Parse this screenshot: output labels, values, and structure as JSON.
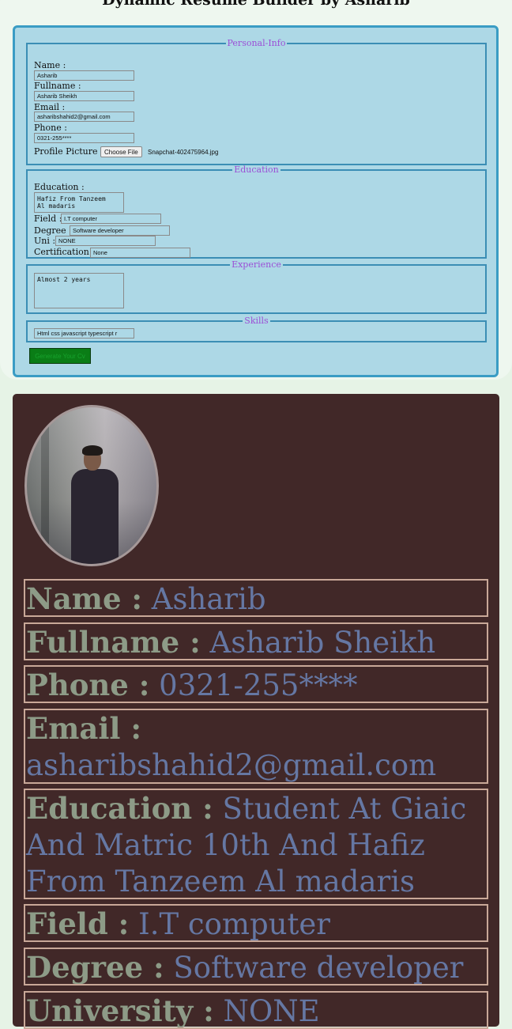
{
  "app": {
    "title": "Dynamic Resume Builder by Asharib"
  },
  "form": {
    "personal": {
      "legend": "Personal-Info",
      "name_label": "Name :",
      "name_value": "Asharib",
      "fullname_label": "Fullname :",
      "fullname_value": "Asharib Sheikh",
      "email_label": "Email :",
      "email_value": "asharibshahid2@gmail.com",
      "phone_label": "Phone :",
      "phone_value": "0321-255****",
      "picture_label": "Profile Picture :",
      "choose_file": "Choose File",
      "file_name": "Snapchat-402475964.jpg"
    },
    "education": {
      "legend": "Education",
      "education_label": "Education :",
      "education_value": "Hafiz From Tanzeem\nAl madaris",
      "field_label": "Field :",
      "field_value": "I.T computer",
      "degree_label": "Degree :",
      "degree_value": "Software developer",
      "uni_label": "Uni :",
      "uni_value": "NONE",
      "certification_label": "Certification :",
      "certification_value": "None"
    },
    "experience": {
      "legend": "Experience",
      "value": "Almost 2 years"
    },
    "skills": {
      "legend": "Skills",
      "value": "Html css javascript typescript r"
    },
    "generate_button": "Generate Your Cv"
  },
  "resume": {
    "name_label": "Name :",
    "name_value": "Asharib",
    "fullname_label": "Fullname :",
    "fullname_value": "Asharib Sheikh",
    "phone_label": "Phone :",
    "phone_value": "0321-255****",
    "email_label": "Email :",
    "email_value": "asharibshahid2@gmail.com",
    "education_label": "Education :",
    "education_value": "Student At Giaic And Matric 10th And Hafiz From Tanzeem Al madaris",
    "field_label": "Field :",
    "field_value": "I.T computer",
    "degree_label": "Degree :",
    "degree_value": "Software developer",
    "university_label": "University :",
    "university_value": "NONE"
  },
  "colors": {
    "form_bg": "#add8e6",
    "resume_bg": "#412828",
    "label": "#8d9b87",
    "value": "#6577a3",
    "button": "#0a7d16"
  }
}
